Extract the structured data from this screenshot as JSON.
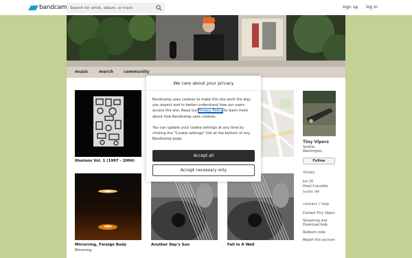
{
  "header": {
    "logo_text": "bandcamp",
    "search_placeholder": "Search for artist, album, or track",
    "signup": "sign up",
    "login": "log in"
  },
  "nav": {
    "music": "music",
    "merch": "merch",
    "community": "community"
  },
  "albums": [
    {
      "title": "Illusionz Vol. 1 (1997 - 2004)",
      "subtitle": ""
    },
    {
      "title": "Mirrorring, Foreign Body",
      "subtitle": "Mirrorring"
    },
    {
      "title": "Another Day's Sun",
      "subtitle": ""
    },
    {
      "title": "Fell In A Well",
      "subtitle": ""
    }
  ],
  "artist": {
    "name": "Tiny Vipers",
    "location_line1": "Seattle,",
    "location_line2": "Washington",
    "follow": "Follow"
  },
  "shows": {
    "heading": "shows",
    "date": "Jun 20",
    "venue": "Hotel Crocodile",
    "city": "Seattle, WA"
  },
  "contact": {
    "heading": "contact / help",
    "links": [
      "Contact Tiny Vipers",
      "Streaming and",
      "Download help",
      "Redeem code",
      "Report this account"
    ]
  },
  "cookie_dialog": {
    "title": "We care about your privacy",
    "para1_before": "Bandcamp uses cookies to make the site work the way you expect and to better understand how our users access the site. Read our",
    "privacy_link": "Privacy Policy",
    "para1_after": "to learn more about how Bandcamp uses cookies.",
    "para2": "You can update your cookie settings at any time by clicking the \"Cookie settings\" link at the bottom of any Bandcamp page.",
    "accept_all": "Accept all",
    "accept_necessary": "Accept necessary only"
  },
  "colors": {
    "background": "#c3d194",
    "nav_bar": "#d9d1c7",
    "logo_accent": "#1da0c3",
    "accept_button": "#2d2d2d"
  }
}
